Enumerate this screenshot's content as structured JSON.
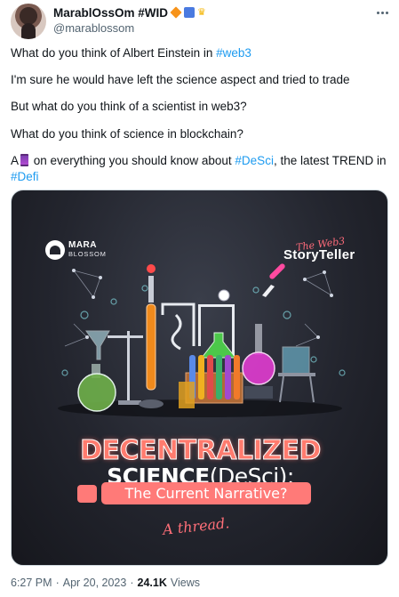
{
  "author": {
    "display_name": "MarablOssOm #WID",
    "handle": "@marablossom",
    "badges": [
      "orange-diamond-icon",
      "chart-icon",
      "crown-icon"
    ],
    "avatar_icon": "profile-photo"
  },
  "more_icon": "more-options-icon",
  "tweet": {
    "lines": [
      {
        "text": "What do you think of Albert Einstein in ",
        "tag": "#web3"
      },
      {
        "text": "I'm sure he would have left the science aspect and tried to trade"
      },
      {
        "text": "But what do you think of a scientist in web3?"
      },
      {
        "text": "What do you think of science in blockchain?"
      }
    ],
    "thread_line": {
      "prefix": "A",
      "icon": "thread-spool-icon",
      "text_before_tag": " on everything you should know about ",
      "tag1": "#DeSci",
      "text_after_tag": ", the latest TREND in",
      "tag2": "#Defi"
    }
  },
  "media": {
    "brand_name": "MARA",
    "brand_sub": "BLOSSOM",
    "story_pre": "The Web3",
    "story_main": "StoryTeller",
    "headline_line1": "DECENTRALIZED",
    "headline_line2_bold": "SCIENCE",
    "headline_line2_light": "(DeSci):",
    "subtitle": "The Current Narrative?",
    "signature": "A thread."
  },
  "footer": {
    "time": "6:27 PM",
    "separator": "·",
    "date": "Apr 20, 2023",
    "separator2": "·",
    "views_count": "24.1K",
    "views_label": "Views"
  },
  "colors": {
    "link": "#1d9bf0",
    "accent_pink": "#ff7a78",
    "media_bg": "#23252e"
  }
}
